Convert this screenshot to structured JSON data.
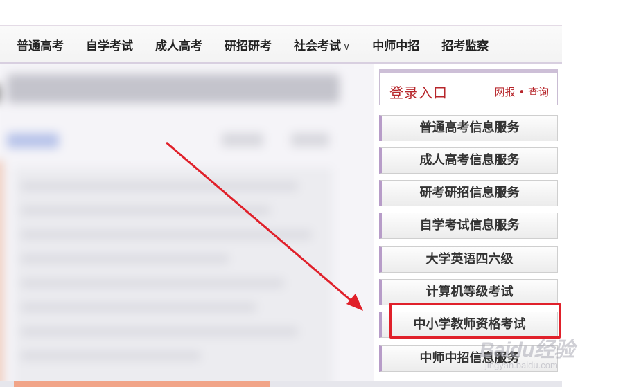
{
  "nav": {
    "items": [
      {
        "label": "普通高考"
      },
      {
        "label": "自学考试"
      },
      {
        "label": "成人高考"
      },
      {
        "label": "研招研考"
      },
      {
        "label": "社会考试",
        "chevron": "chevron-down-icon"
      },
      {
        "label": "中师中招"
      },
      {
        "label": "招考监察"
      }
    ],
    "chevron_glyph": "∨"
  },
  "sidebar": {
    "login_title": "登录入口",
    "login_links": {
      "left": "网报",
      "separator": "•",
      "right": "查询"
    },
    "services": [
      {
        "label": "普通高考信息服务"
      },
      {
        "label": "成人高考信息服务"
      },
      {
        "label": "研考研招信息服务"
      },
      {
        "label": "自学考试信息服务"
      },
      {
        "label": "大学英语四六级"
      },
      {
        "label": "计算机等级考试"
      },
      {
        "label": "中小学教师资格考试"
      },
      {
        "label": "中师中招信息服务"
      }
    ]
  },
  "watermark": {
    "main": "Baidu经验",
    "sub": "jingyan.baidu.com"
  },
  "colors": {
    "accent_red": "#b7262b",
    "highlight_red": "#e0202a",
    "button_border_left": "#b79cc8"
  }
}
